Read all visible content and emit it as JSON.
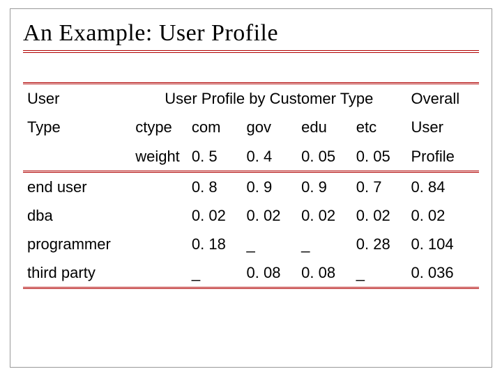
{
  "title": "An Example: User Profile",
  "header": {
    "left_line1": "User",
    "left_line2": "Type",
    "span_label": "User Profile by Customer Type",
    "ctype_label": "ctype",
    "weight_label": "weight",
    "cols": {
      "com": "com",
      "gov": "gov",
      "edu": "edu",
      "etc": "etc"
    },
    "weights": {
      "com": "0. 5",
      "gov": "0. 4",
      "edu": "0. 05",
      "etc": "0. 05"
    },
    "overall_line1": "Overall",
    "overall_line2": "User",
    "overall_line3": "Profile"
  },
  "rows": [
    {
      "label": "end user",
      "com": "0. 8",
      "gov": "0. 9",
      "edu": "0. 9",
      "etc": "0. 7",
      "overall": "0. 84"
    },
    {
      "label": "dba",
      "com": "0. 02",
      "gov": "0. 02",
      "edu": "0. 02",
      "etc": "0. 02",
      "overall": "0. 02"
    },
    {
      "label": "programmer",
      "com": "0. 18",
      "gov": "_",
      "edu": "_",
      "etc": "0. 28",
      "overall": "0. 104"
    },
    {
      "label": "third party",
      "com": "_",
      "gov": "0. 08",
      "edu": "0. 08",
      "etc": "_",
      "overall": "0. 036"
    }
  ],
  "chart_data": {
    "type": "table",
    "title": "User Profile by Customer Type",
    "customer_types": [
      "com",
      "gov",
      "edu",
      "etc"
    ],
    "weights": [
      0.5,
      0.4,
      0.05,
      0.05
    ],
    "user_types": [
      "end user",
      "dba",
      "programmer",
      "third party"
    ],
    "values": [
      [
        0.8,
        0.9,
        0.9,
        0.7
      ],
      [
        0.02,
        0.02,
        0.02,
        0.02
      ],
      [
        0.18,
        null,
        null,
        0.28
      ],
      [
        null,
        0.08,
        0.08,
        null
      ]
    ],
    "overall_user_profile": [
      0.84,
      0.02,
      0.104,
      0.036
    ]
  }
}
